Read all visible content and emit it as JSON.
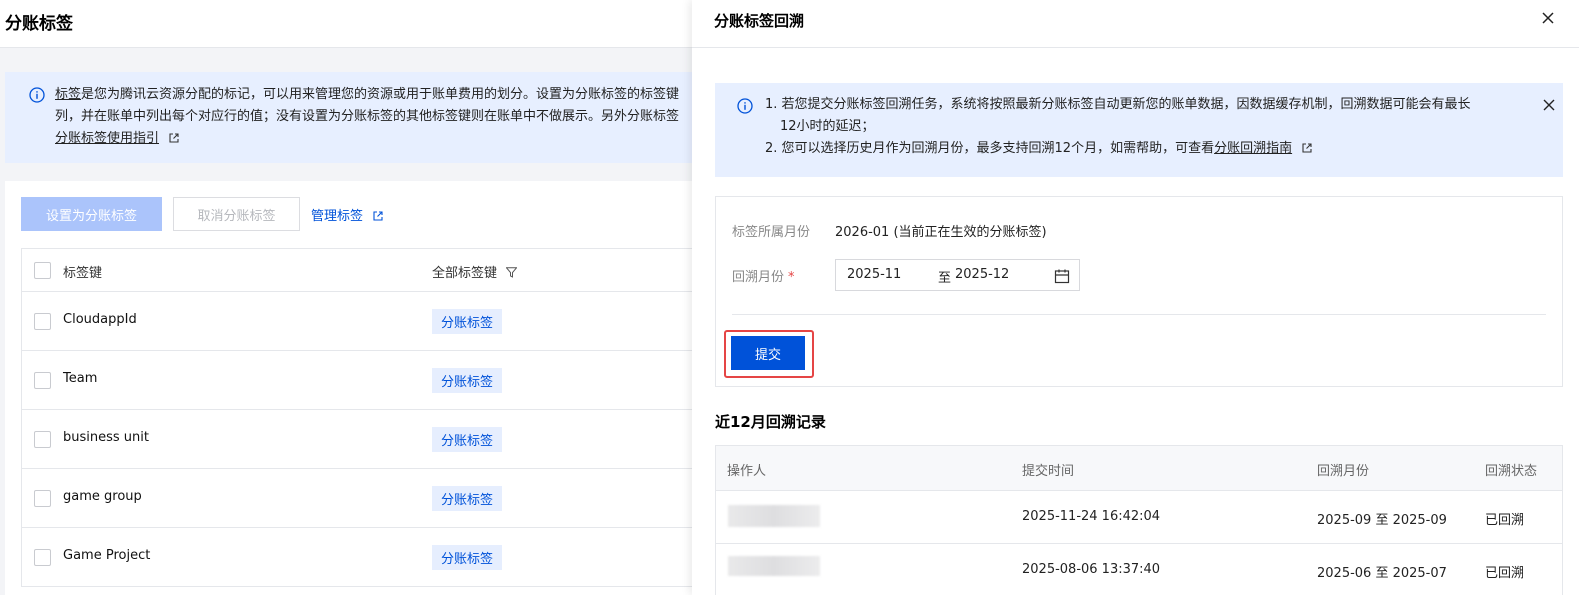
{
  "page": {
    "title": "分账标签",
    "info": {
      "link_tag": "标签",
      "line1_rest": "是您为腾讯云资源分配的标记，可以用来管理您的资源或用于账单费用的划分。设置为分账标签的标签键",
      "line2": "列，并在账单中列出每个对应行的值；没有设置为分账标签的其他标签键则在账单中不做展示。另外分账标签",
      "guide_link": "分账标签使用指引"
    },
    "toolbar": {
      "set_label": "设置为分账标签",
      "cancel_label": "取消分账标签",
      "manage_label": "管理标签"
    },
    "table": {
      "headers": {
        "key": "标签键",
        "type": "全部标签键"
      },
      "rows": [
        {
          "key": "CloudappId",
          "tag": "分账标签"
        },
        {
          "key": "Team",
          "tag": "分账标签"
        },
        {
          "key": "business unit",
          "tag": "分账标签"
        },
        {
          "key": "game group",
          "tag": "分账标签"
        },
        {
          "key": "Game Project",
          "tag": "分账标签"
        }
      ]
    }
  },
  "drawer": {
    "title": "分账标签回溯",
    "notice": {
      "line1": "1. 若您提交分账标签回溯任务，系统将按照最新分账标签自动更新您的账单数据，因数据缓存机制，回溯数据可能会有最长",
      "line1b": "12小时的延迟；",
      "line2_prefix": "2. 您可以选择历史月作为回溯月份，最多支持回溯12个月，如需帮助，可查看",
      "line2_link": "分账回溯指南"
    },
    "form": {
      "month_label": "标签所属月份",
      "month_value": "2026-01 (当前正在生效的分账标签)",
      "range_label": "回溯月份",
      "required_mark": "*",
      "range_start": "2025-11",
      "range_sep": "至",
      "range_end": "2025-12",
      "submit_label": "提交"
    },
    "history": {
      "title": "近12月回溯记录",
      "headers": {
        "operator": "操作人",
        "time": "提交时间",
        "months": "回溯月份",
        "status": "回溯状态"
      },
      "rows": [
        {
          "time": "2025-11-24 16:42:04",
          "months": "2025-09 至 2025-09",
          "status": "已回溯"
        },
        {
          "time": "2025-08-06 13:37:40",
          "months": "2025-06 至 2025-07",
          "status": "已回溯"
        }
      ]
    }
  },
  "colors": {
    "primary": "#0052d9",
    "banner": "#e7efff",
    "highlight": "#e54545"
  }
}
